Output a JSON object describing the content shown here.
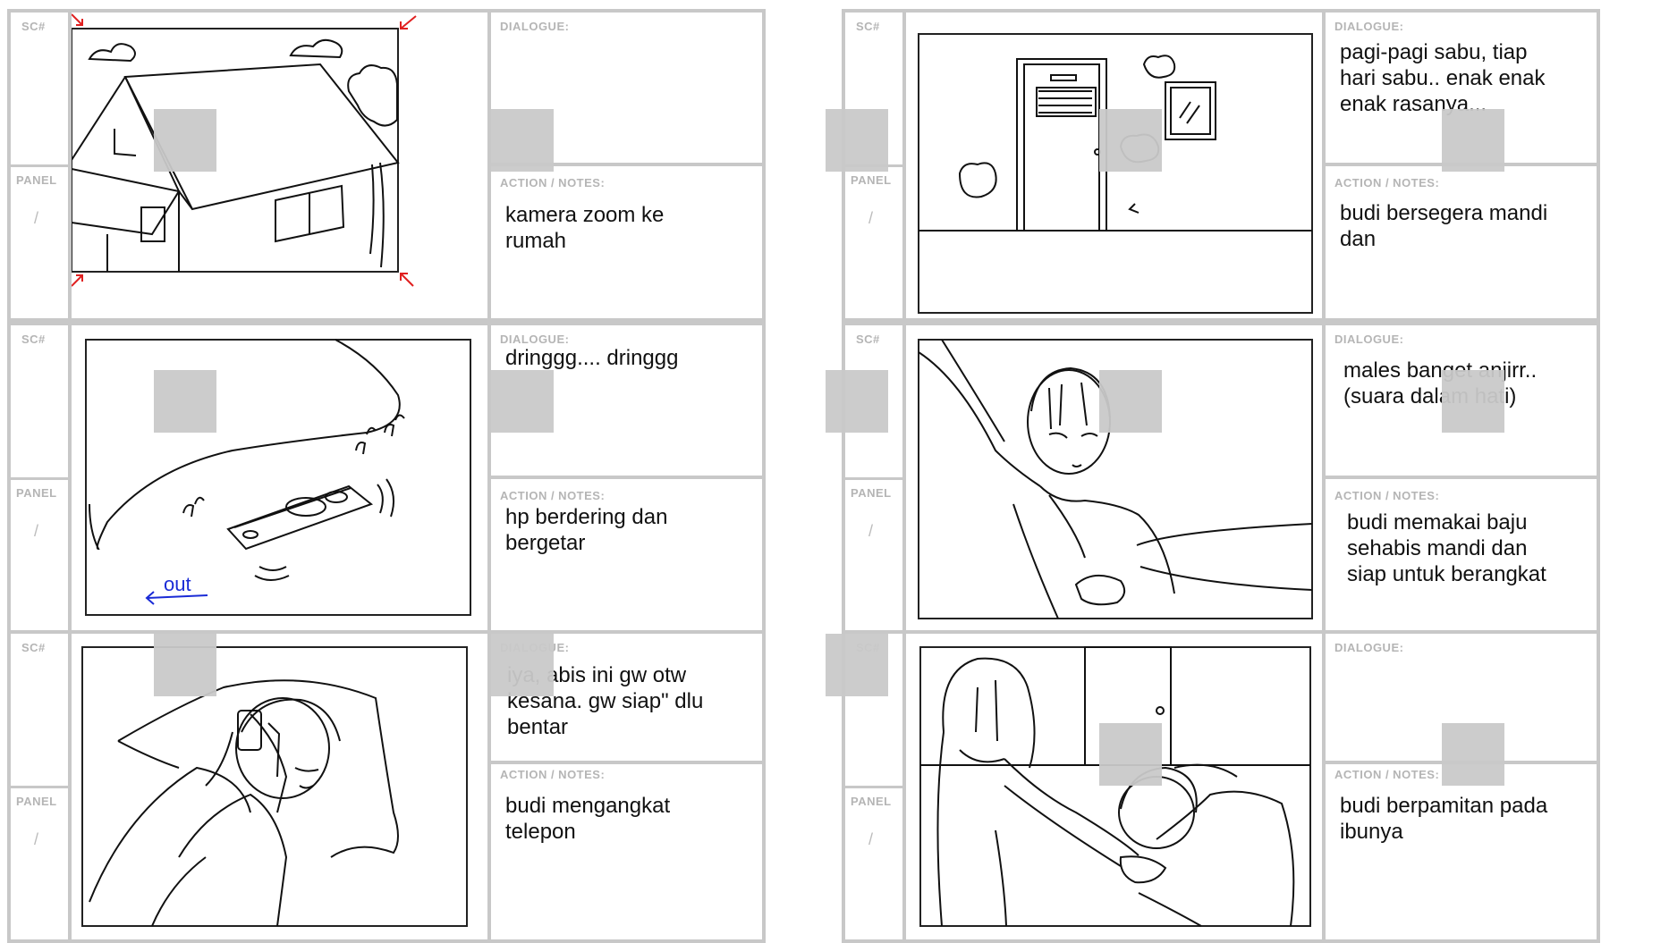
{
  "labels": {
    "sc": "SC#",
    "panel": "PANEL",
    "panel_slash": "/",
    "dialogue": "DIALOGUE:",
    "action": "ACTION",
    "notes": " / NOTES:"
  },
  "left": {
    "rows": [
      {
        "dialogue": "",
        "action": "kamera zoom ke\nrumah",
        "sketch": "house-exterior"
      },
      {
        "dialogue": "dringgg.... dringgg",
        "action": "hp berdering dan\nbergetar",
        "sketch": "ringing-phone",
        "annotation": "out"
      },
      {
        "dialogue": "iya, abis ini gw otw\nkesana. gw siap\" dlu\nbentar",
        "action": "budi mengangkat\ntelepon",
        "sketch": "boy-in-bed-answering-phone"
      }
    ]
  },
  "right": {
    "rows": [
      {
        "dialogue": "pagi-pagi sabu, tiap\nhari sabu.. enak enak\nenak rasanya...",
        "action": "budi bersegera mandi\ndan",
        "sketch": "bathroom-door"
      },
      {
        "dialogue": "males banget anjirr..\n(suara dalam hati)",
        "action": "budi memakai baju\nsehabis mandi dan\nsiap untuk berangkat",
        "sketch": "boy-dressing"
      },
      {
        "dialogue": "",
        "action": "budi berpamitan pada\nibunya",
        "sketch": "boy-bowing-to-mother"
      }
    ]
  },
  "colors": {
    "border": "#c8c8c8",
    "label": "#b5b5b5",
    "annotation": "#1a2bd6",
    "zoom_arrows": "#e02020"
  }
}
